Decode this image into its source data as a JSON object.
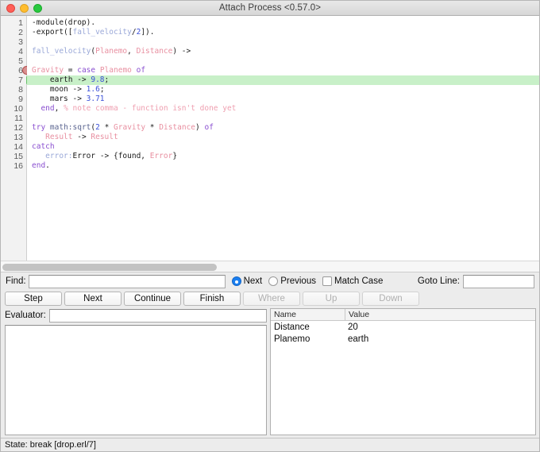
{
  "window": {
    "title": "Attach Process <0.57.0>",
    "controls": {
      "close": "close",
      "minimize": "minimize",
      "maximize": "maximize"
    }
  },
  "editor": {
    "line_numbers": [
      "1",
      "2",
      "3",
      "4",
      "5",
      "6",
      "7",
      "8",
      "9",
      "10",
      "11",
      "12",
      "13",
      "14",
      "15",
      "16"
    ],
    "breakpoint_line": 6,
    "current_line": 7,
    "lines": [
      {
        "n": 1,
        "tokens": [
          {
            "t": "plain",
            "s": "-module(drop)."
          }
        ]
      },
      {
        "n": 2,
        "tokens": [
          {
            "t": "plain",
            "s": "-export(["
          },
          {
            "t": "func",
            "s": "fall_velocity"
          },
          {
            "t": "plain",
            "s": "/"
          },
          {
            "t": "num",
            "s": "2"
          },
          {
            "t": "plain",
            "s": "])."
          }
        ]
      },
      {
        "n": 3,
        "tokens": [
          {
            "t": "plain",
            "s": ""
          }
        ]
      },
      {
        "n": 4,
        "tokens": [
          {
            "t": "func",
            "s": "fall_velocity"
          },
          {
            "t": "plain",
            "s": "("
          },
          {
            "t": "var",
            "s": "Planemo"
          },
          {
            "t": "plain",
            "s": ", "
          },
          {
            "t": "var",
            "s": "Distance"
          },
          {
            "t": "plain",
            "s": ") ->"
          }
        ]
      },
      {
        "n": 5,
        "tokens": [
          {
            "t": "plain",
            "s": ""
          }
        ]
      },
      {
        "n": 6,
        "tokens": [
          {
            "t": "var",
            "s": "Gravity"
          },
          {
            "t": "plain",
            "s": " = "
          },
          {
            "t": "kw",
            "s": "case"
          },
          {
            "t": "plain",
            "s": " "
          },
          {
            "t": "var",
            "s": "Planemo"
          },
          {
            "t": "plain",
            "s": " "
          },
          {
            "t": "kw",
            "s": "of"
          }
        ]
      },
      {
        "n": 7,
        "tokens": [
          {
            "t": "plain",
            "s": "    earth -> "
          },
          {
            "t": "num",
            "s": "9.8"
          },
          {
            "t": "plain",
            "s": ";"
          }
        ]
      },
      {
        "n": 8,
        "tokens": [
          {
            "t": "plain",
            "s": "    moon -> "
          },
          {
            "t": "num",
            "s": "1.6"
          },
          {
            "t": "plain",
            "s": ";"
          }
        ]
      },
      {
        "n": 9,
        "tokens": [
          {
            "t": "plain",
            "s": "    mars -> "
          },
          {
            "t": "num",
            "s": "3.71"
          }
        ]
      },
      {
        "n": 10,
        "tokens": [
          {
            "t": "kw",
            "s": "  end"
          },
          {
            "t": "plain",
            "s": ", "
          },
          {
            "t": "com",
            "s": "% note comma - function isn't done yet"
          }
        ]
      },
      {
        "n": 11,
        "tokens": [
          {
            "t": "plain",
            "s": ""
          }
        ]
      },
      {
        "n": 12,
        "tokens": [
          {
            "t": "kw",
            "s": "try"
          },
          {
            "t": "plain",
            "s": " "
          },
          {
            "t": "mod",
            "s": "math:sqrt"
          },
          {
            "t": "plain",
            "s": "("
          },
          {
            "t": "num",
            "s": "2"
          },
          {
            "t": "plain",
            "s": " * "
          },
          {
            "t": "var",
            "s": "Gravity"
          },
          {
            "t": "plain",
            "s": " * "
          },
          {
            "t": "var",
            "s": "Distance"
          },
          {
            "t": "plain",
            "s": ") "
          },
          {
            "t": "kw",
            "s": "of"
          }
        ]
      },
      {
        "n": 13,
        "tokens": [
          {
            "t": "plain",
            "s": "   "
          },
          {
            "t": "var",
            "s": "Result"
          },
          {
            "t": "plain",
            "s": " -> "
          },
          {
            "t": "var",
            "s": "Result"
          }
        ]
      },
      {
        "n": 14,
        "tokens": [
          {
            "t": "kw",
            "s": "catch"
          }
        ]
      },
      {
        "n": 15,
        "tokens": [
          {
            "t": "plain",
            "s": "   "
          },
          {
            "t": "err",
            "s": "error:"
          },
          {
            "t": "plain",
            "s": "Error -> {found, "
          },
          {
            "t": "var",
            "s": "Error"
          },
          {
            "t": "plain",
            "s": "}"
          }
        ]
      },
      {
        "n": 16,
        "tokens": [
          {
            "t": "kw",
            "s": "end"
          },
          {
            "t": "plain",
            "s": "."
          }
        ]
      }
    ]
  },
  "find": {
    "label": "Find:",
    "value": "",
    "placeholder": "",
    "next_label": "Next",
    "previous_label": "Previous",
    "match_case_label": "Match Case",
    "direction_selected": "Next",
    "match_case_checked": false,
    "goto_label": "Goto Line:",
    "goto_value": "",
    "goto_placeholder": ""
  },
  "buttons": [
    {
      "label": "Step",
      "enabled": true
    },
    {
      "label": "Next",
      "enabled": true
    },
    {
      "label": "Continue",
      "enabled": true
    },
    {
      "label": "Finish",
      "enabled": true
    },
    {
      "label": "Where",
      "enabled": false
    },
    {
      "label": "Up",
      "enabled": false
    },
    {
      "label": "Down",
      "enabled": false
    }
  ],
  "evaluator": {
    "label": "Evaluator:",
    "value": "",
    "placeholder": "",
    "output": ""
  },
  "bindings": {
    "columns": [
      "Name",
      "Value"
    ],
    "rows": [
      {
        "name": "Distance",
        "value": "20"
      },
      {
        "name": "Planemo",
        "value": "earth"
      }
    ]
  },
  "status": {
    "text": "State: break [drop.erl/7]"
  },
  "colors": {
    "highlight_line": "#c8f0c8",
    "breakpoint": "#b05050",
    "arrow": "#69c169",
    "accent_radio": "#1a7ef0",
    "keyword": "#8a4fd0",
    "variable": "#e88fa0",
    "number": "#3a4fd8",
    "comment": "#ef9fb0"
  }
}
